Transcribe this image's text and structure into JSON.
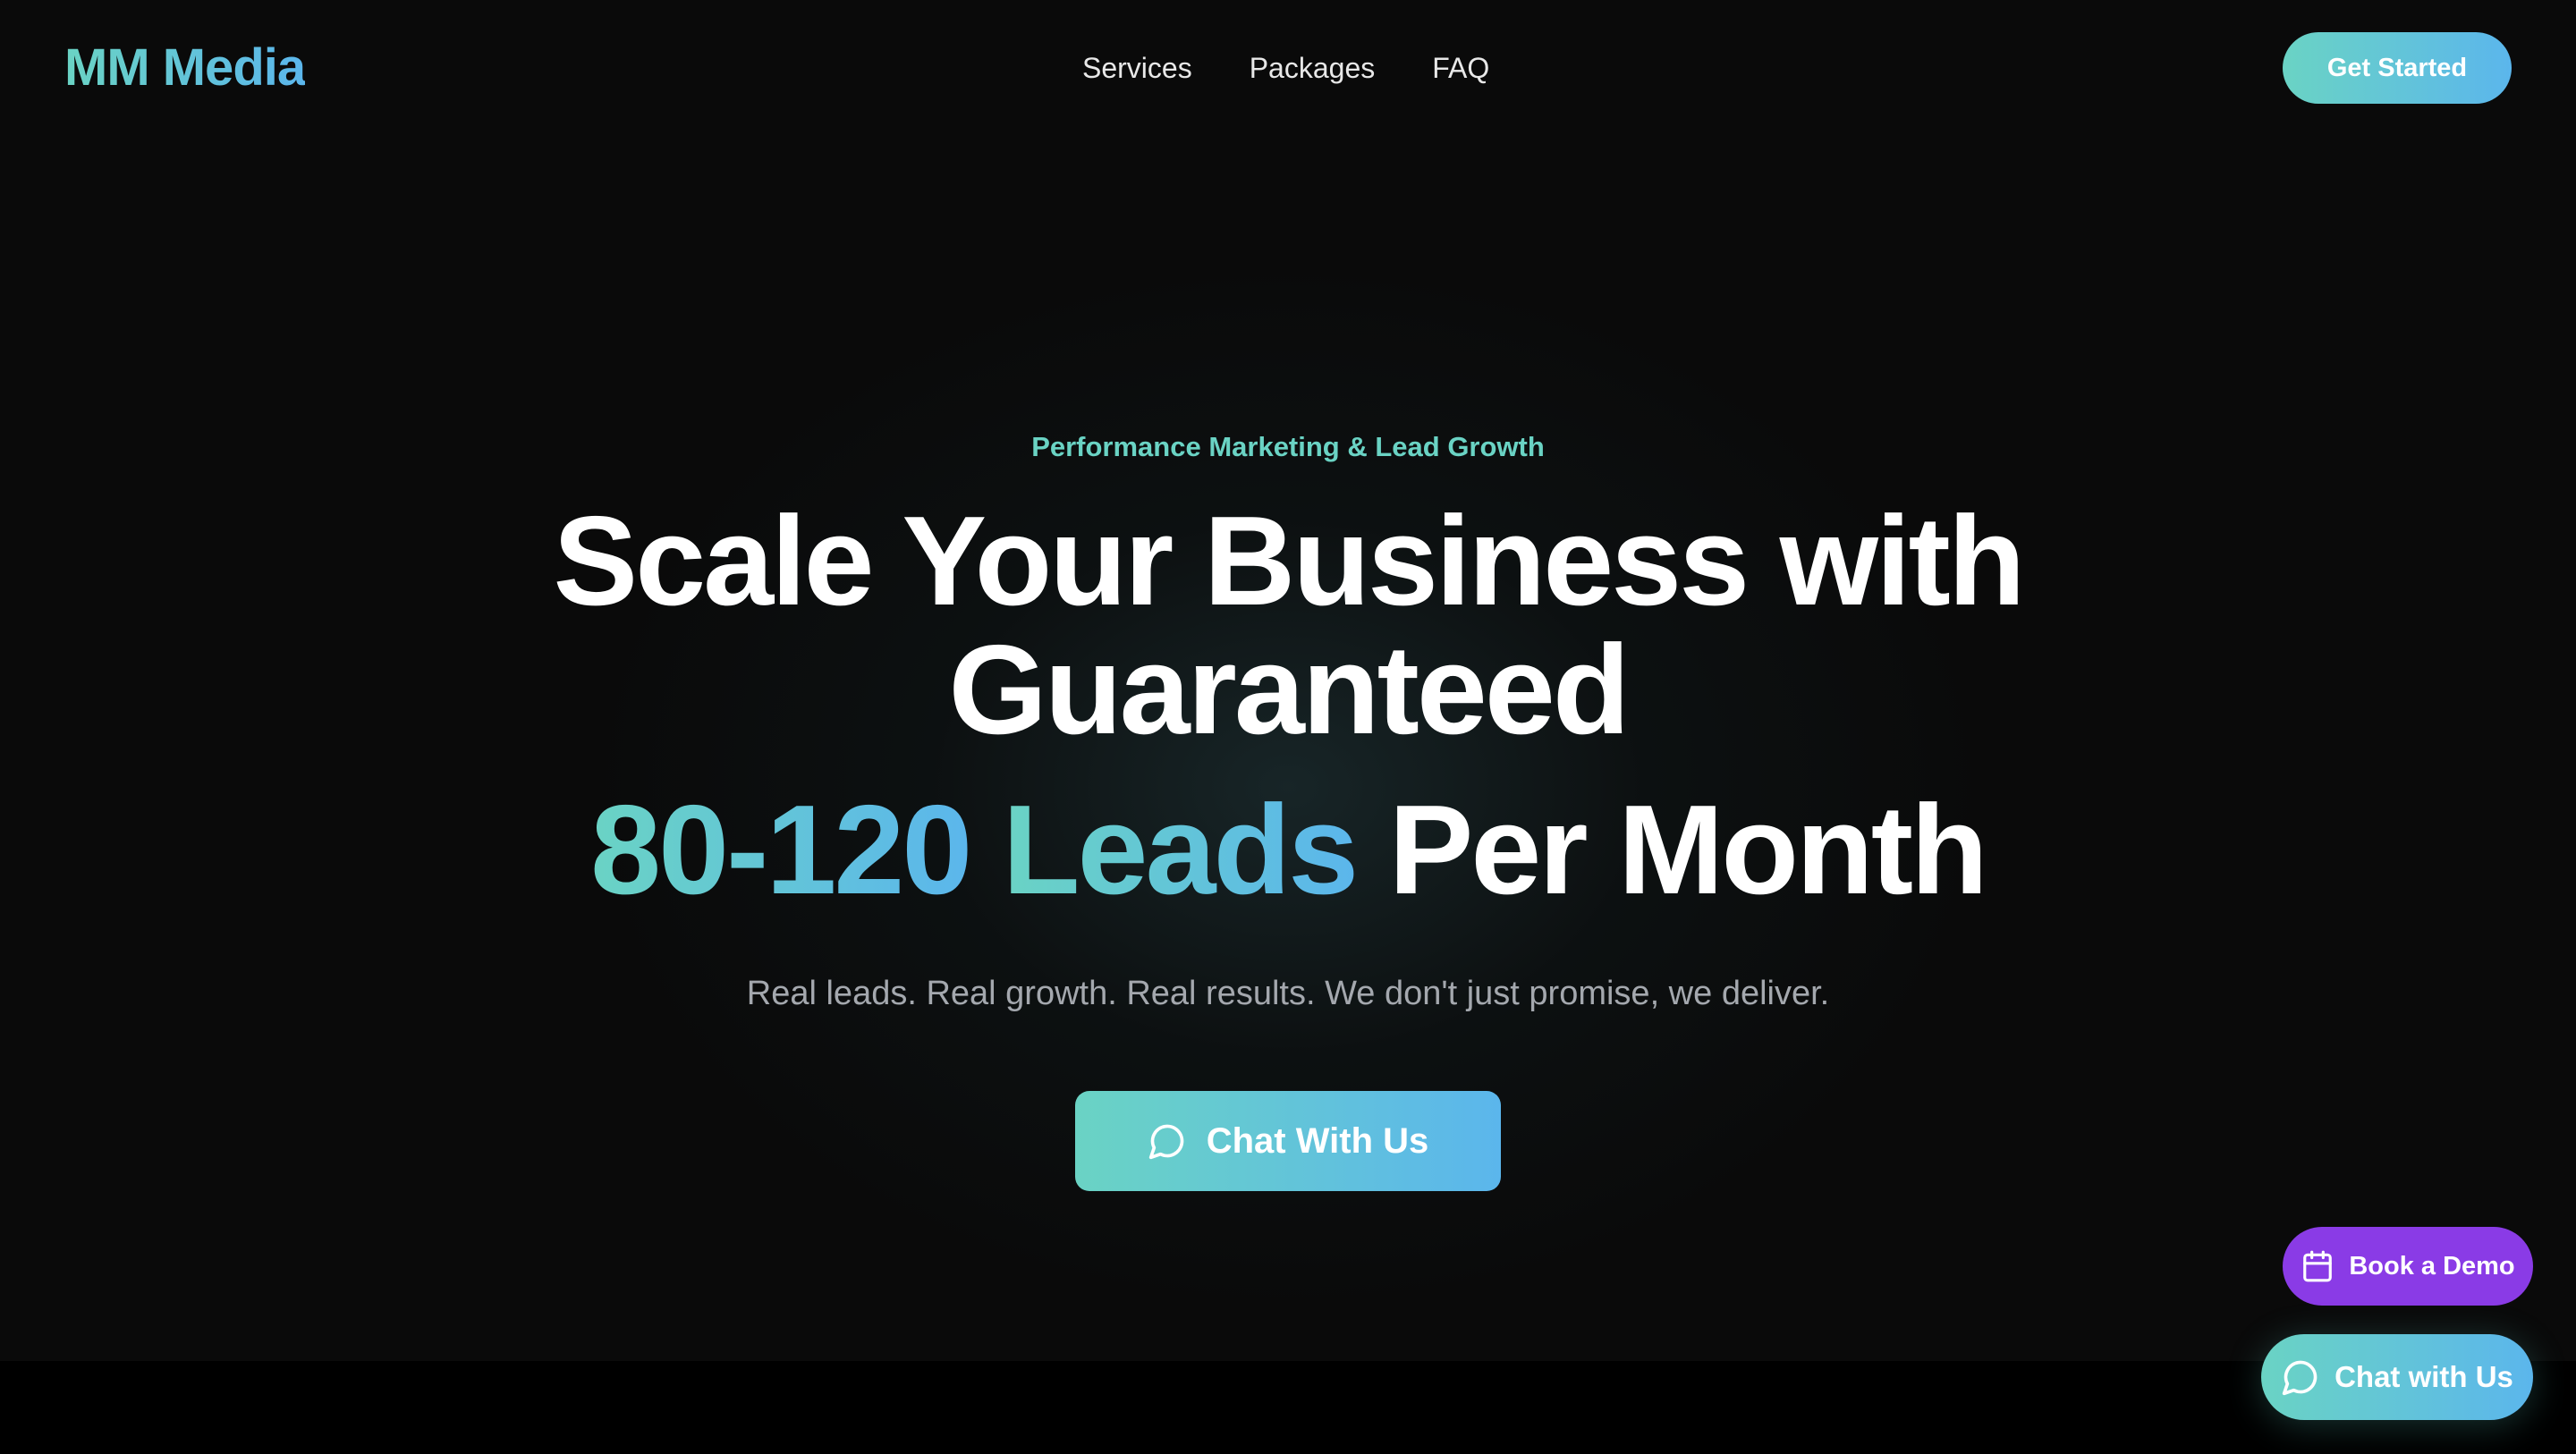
{
  "header": {
    "logo": "MM Media",
    "nav": [
      {
        "label": "Services"
      },
      {
        "label": "Packages"
      },
      {
        "label": "FAQ"
      }
    ],
    "cta_label": "Get Started"
  },
  "hero": {
    "eyebrow": "Performance Marketing & Lead Growth",
    "headline_line1": "Scale Your Business with",
    "headline_line2": "Guaranteed",
    "highlight_number": "80-120",
    "highlight_word": "Leads",
    "headline_tail": "Per Month",
    "subtitle": "Real leads. Real growth. Real results. We don't just promise, we deliver.",
    "cta_label": "Chat With Us",
    "cta_icon": "chat-bubble-icon"
  },
  "floating": {
    "book_demo_label": "Book a Demo",
    "book_demo_icon": "calendar-icon",
    "chat_label": "Chat with Us",
    "chat_icon": "chat-bubble-icon"
  },
  "colors": {
    "background": "#0a0a0a",
    "accent_teal": "#6ad3c4",
    "accent_blue": "#5bb6ec",
    "demo_purple": "#8a3be6",
    "subtitle_gray": "#a4a8ae"
  }
}
